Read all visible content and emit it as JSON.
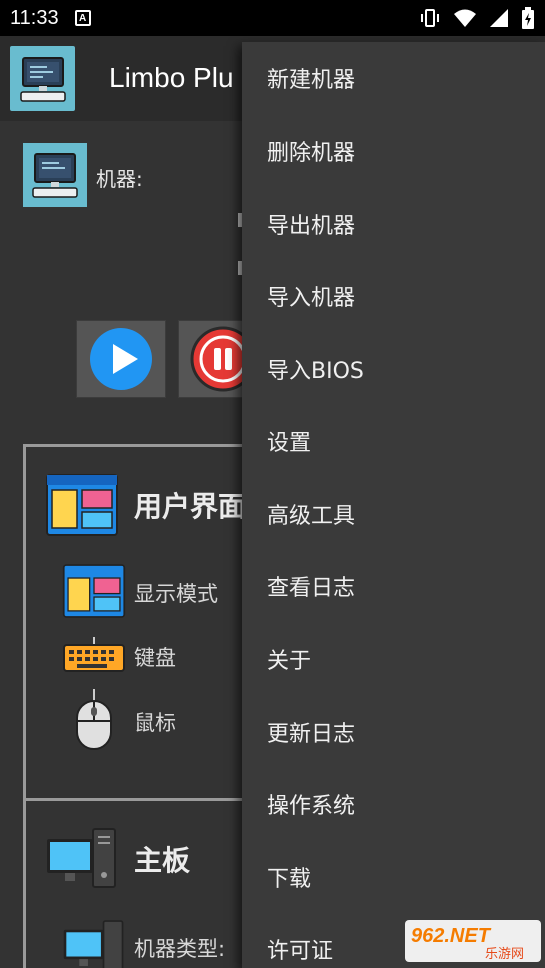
{
  "status_bar": {
    "time": "11:33",
    "notification_badge": "A",
    "icons": [
      "vibrate-icon",
      "wifi-icon",
      "signal-icon",
      "battery-charging-icon"
    ]
  },
  "app_bar": {
    "title": "Limbo Plu",
    "logo_icon": "computer-icon"
  },
  "main": {
    "machine_label": "机器:",
    "controls": [
      "play-icon",
      "pause-icon"
    ],
    "ui_section": {
      "title": "用户界面",
      "rows": [
        {
          "label": "显示模式",
          "icon": "display-window-icon"
        },
        {
          "label": "键盘",
          "icon": "keyboard-icon"
        },
        {
          "label": "鼠标",
          "icon": "mouse-icon"
        }
      ]
    },
    "board_section": {
      "title": "主板",
      "rows": [
        {
          "label": "机器类型:",
          "icon": "desktop-computer-icon"
        }
      ]
    }
  },
  "menu": {
    "items": [
      "新建机器",
      "删除机器",
      "导出机器",
      "导入机器",
      "导入BIOS",
      "设置",
      "高级工具",
      "查看日志",
      "关于",
      "更新日志",
      "操作系统",
      "下载",
      "许可证"
    ]
  },
  "watermark": {
    "text_top": "962.NET",
    "text_bottom": "乐游网"
  },
  "colors": {
    "background": "#333333",
    "menu": "#3a3a3a",
    "accent_blue": "#2196f3",
    "accent_red": "#e53935",
    "logo_teal": "#69bccf"
  }
}
